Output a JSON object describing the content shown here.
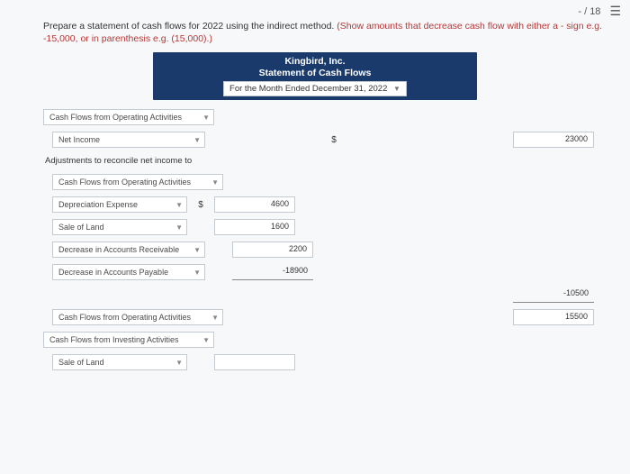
{
  "topbar": {
    "score": "- / 18"
  },
  "instruction": {
    "main": "Prepare a statement of cash flows for 2022 using the indirect method. ",
    "paren_a": "(Show amounts that decrease cash flow with either a - sign e.g. ",
    "paren_b": "-15,000, or in parenthesis e.g. (15,000).)"
  },
  "header": {
    "company": "Kingbird, Inc.",
    "statement": "Statement of Cash Flows",
    "period": "For the Month Ended December 31, 2022"
  },
  "labels": {
    "section1": "Cash Flows from Operating Activities",
    "net_income": "Net Income",
    "adjust_text": "Adjustments to reconcile net income to",
    "cfo2": "Cash Flows from Operating Activities",
    "dep": "Depreciation Expense",
    "sale_land": "Sale of Land",
    "dec_ar": "Decrease in Accounts Receivable",
    "dec_ap": "Decrease in Accounts Payable",
    "cfo3": "Cash Flows from Operating Activities",
    "cfi": "Cash Flows from Investing Activities",
    "sale_land2": "Sale of Land"
  },
  "values": {
    "net_income": "23000",
    "dep": "4600",
    "sale_land": "1600",
    "dec_ar": "2200",
    "dec_ap": "-18900",
    "subtotal_adj": "-10500",
    "total_cfo": "15500"
  },
  "sym": {
    "dollar": "$"
  }
}
